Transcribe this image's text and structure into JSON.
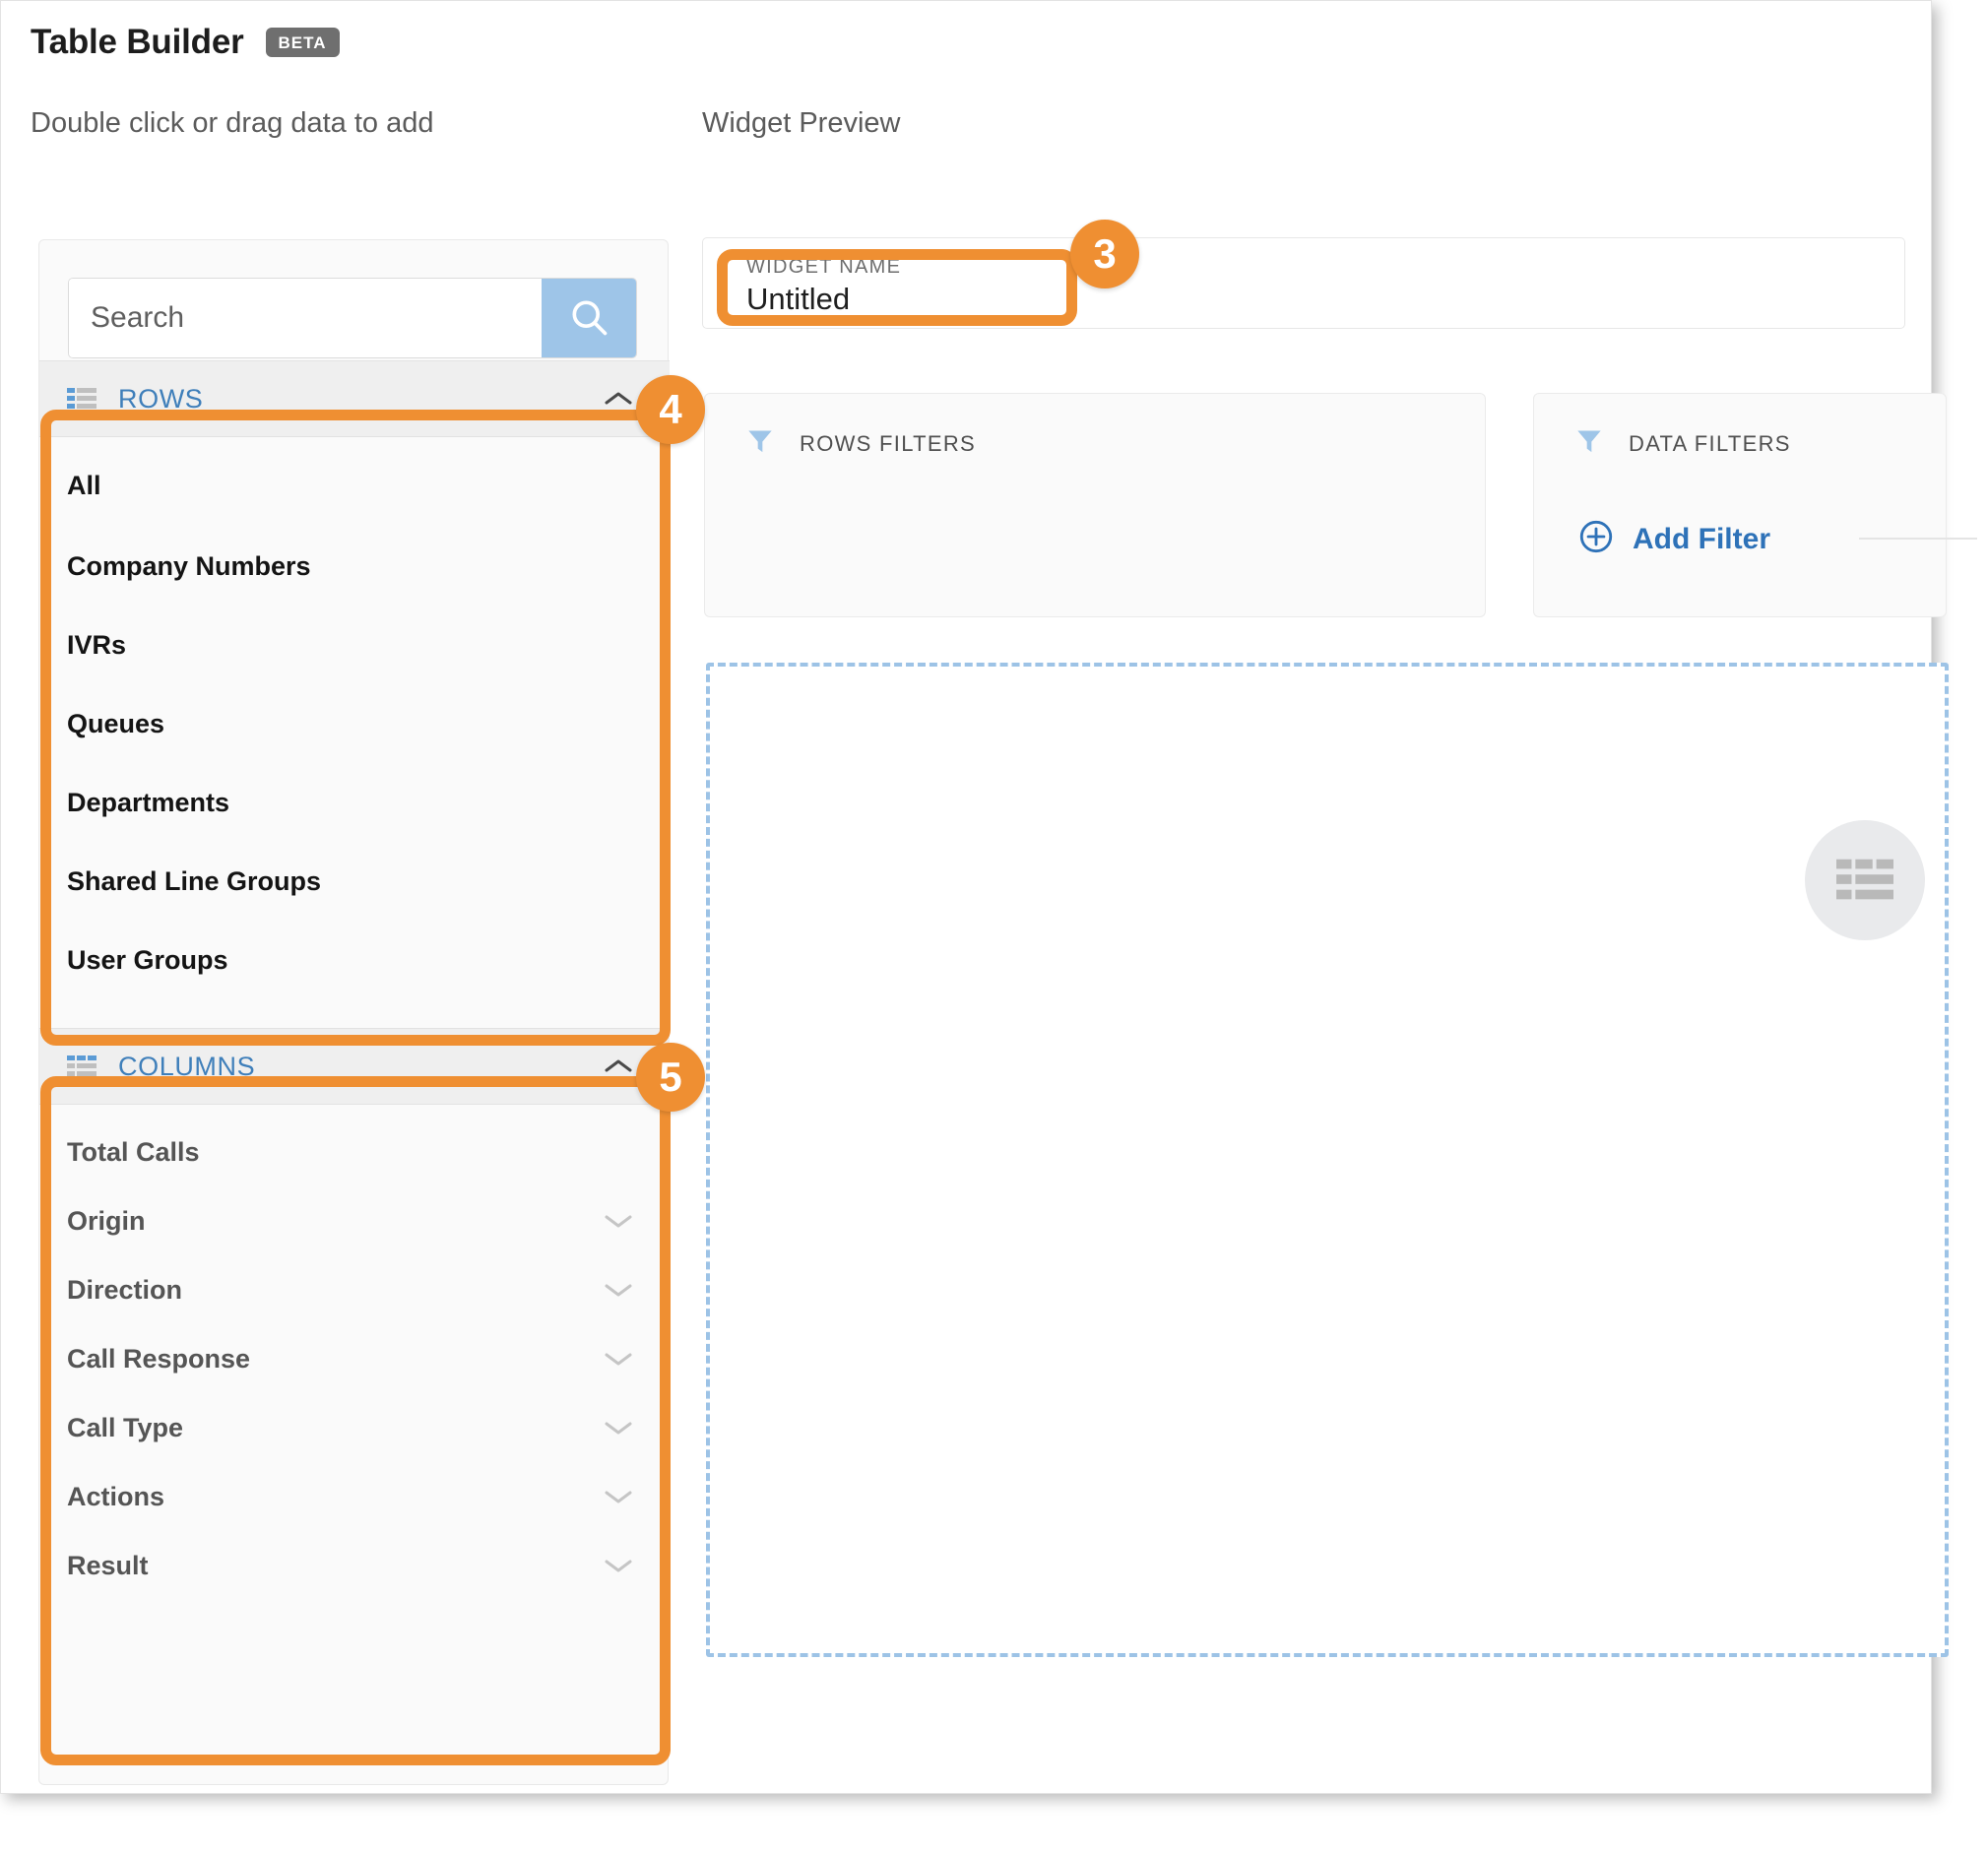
{
  "header": {
    "title": "Table Builder",
    "badge": "BETA"
  },
  "left": {
    "subtitle": "Double click or drag data to add",
    "search": {
      "placeholder": "Search",
      "value": "",
      "icon": "search-icon"
    },
    "groups": [
      {
        "id": "rows",
        "title": "ROWS",
        "icon": "table-rows-icon",
        "chevron": "chevron-up-icon",
        "expanded": true,
        "items": [
          {
            "label": "All",
            "chevron": null
          },
          {
            "label": "Company Numbers",
            "chevron": null
          },
          {
            "label": "IVRs",
            "chevron": null
          },
          {
            "label": "Queues",
            "chevron": null
          },
          {
            "label": "Departments",
            "chevron": null
          },
          {
            "label": "Shared Line Groups",
            "chevron": null
          },
          {
            "label": "User Groups",
            "chevron": null
          }
        ]
      },
      {
        "id": "columns",
        "title": "COLUMNS",
        "icon": "table-columns-icon",
        "chevron": "chevron-up-icon",
        "expanded": true,
        "items": [
          {
            "label": "Total Calls",
            "chevron": null
          },
          {
            "label": "Origin",
            "chevron": "chevron-down-icon"
          },
          {
            "label": "Direction",
            "chevron": "chevron-down-icon"
          },
          {
            "label": "Call Response",
            "chevron": "chevron-down-icon"
          },
          {
            "label": "Call Type",
            "chevron": "chevron-down-icon"
          },
          {
            "label": "Actions",
            "chevron": "chevron-down-icon"
          },
          {
            "label": "Result",
            "chevron": "chevron-down-icon"
          }
        ]
      }
    ]
  },
  "right": {
    "subtitle": "Widget Preview",
    "widget_name": {
      "label": "WIDGET NAME",
      "value": "Untitled"
    },
    "rows_filters": {
      "label": "ROWS FILTERS",
      "icon": "funnel-icon"
    },
    "data_filters": {
      "label": "DATA FILTERS",
      "icon": "funnel-icon",
      "add_filter_label": "Add Filter",
      "add_filter_icon": "plus-circle-icon"
    },
    "drop_zone": {
      "icon": "table-placeholder-icon"
    }
  },
  "callouts": [
    {
      "number": "3",
      "target": "widget-name-field"
    },
    {
      "number": "4",
      "target": "rows-group"
    },
    {
      "number": "5",
      "target": "columns-group"
    }
  ],
  "colors": {
    "callout_orange": "#ef8f32",
    "accent_blue": "#3f7fba",
    "link_blue": "#2e72b8",
    "icon_blue": "#9ec5e8",
    "dashed_blue": "#9dc3e6",
    "badge_gray": "#6f6f6f"
  }
}
